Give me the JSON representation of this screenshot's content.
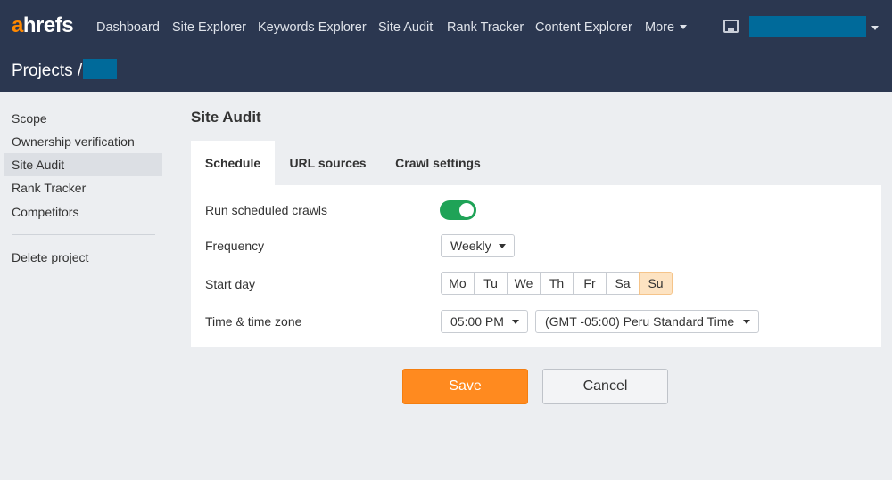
{
  "logo": {
    "first": "a",
    "rest": "hrefs"
  },
  "nav": {
    "items": [
      "Dashboard",
      "Site Explorer",
      "Keywords Explorer",
      "Site Audit",
      "Rank Tracker",
      "Content Explorer"
    ],
    "more": "More"
  },
  "project": {
    "title": "Projects /"
  },
  "sidebar": {
    "items": [
      "Scope",
      "Ownership verification",
      "Site Audit",
      "Rank Tracker",
      "Competitors"
    ],
    "active": "Site Audit",
    "delete": "Delete project"
  },
  "main": {
    "title": "Site Audit",
    "tabs": [
      "Schedule",
      "URL sources",
      "Crawl settings"
    ],
    "active_tab": "Schedule",
    "rows": {
      "run_label": "Run scheduled crawls",
      "run_enabled": true,
      "frequency_label": "Frequency",
      "frequency_value": "Weekly",
      "start_day_label": "Start day",
      "days": [
        "Mo",
        "Tu",
        "We",
        "Th",
        "Fr",
        "Sa",
        "Su"
      ],
      "selected_day": "Su",
      "time_label": "Time & time zone",
      "time_value": "05:00 PM",
      "timezone_value": "(GMT -05:00) Peru Standard Time"
    },
    "save_label": "Save",
    "cancel_label": "Cancel"
  },
  "colors": {
    "header_bg": "#2b3750",
    "accent_orange": "#ff8a1f",
    "toggle_on": "#1fa357",
    "redacted": "#006a9a",
    "selected_day_bg": "#fde3c2"
  }
}
